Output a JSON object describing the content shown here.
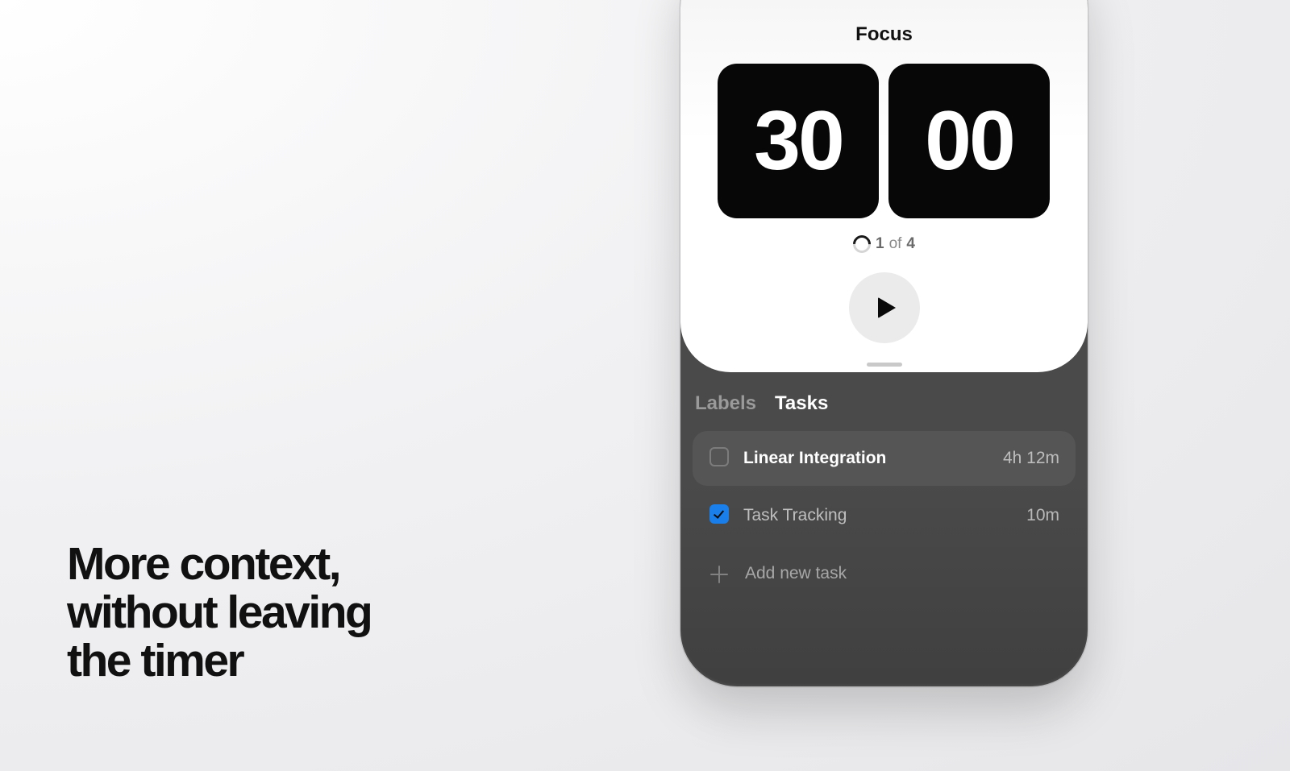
{
  "headline": {
    "line1": "More context,",
    "line2": "without leaving",
    "line3": "the timer"
  },
  "timer": {
    "title": "Focus",
    "minutes": "30",
    "seconds": "00",
    "session_current": "1",
    "session_of": "of",
    "session_total": "4",
    "play_icon": "play-icon"
  },
  "tabs": [
    {
      "label": "Labels",
      "active": false
    },
    {
      "label": "Tasks",
      "active": true
    }
  ],
  "tasks": [
    {
      "name": "Linear Integration",
      "time": "4h 12m",
      "checked": false
    },
    {
      "name": "Task Tracking",
      "time": "10m",
      "checked": true
    }
  ],
  "add_task": {
    "label": "Add new task",
    "icon": "plus-icon"
  },
  "colors": {
    "accent": "#1a82f0",
    "timer_card": "#070707",
    "panel": "#4a4a4a"
  }
}
